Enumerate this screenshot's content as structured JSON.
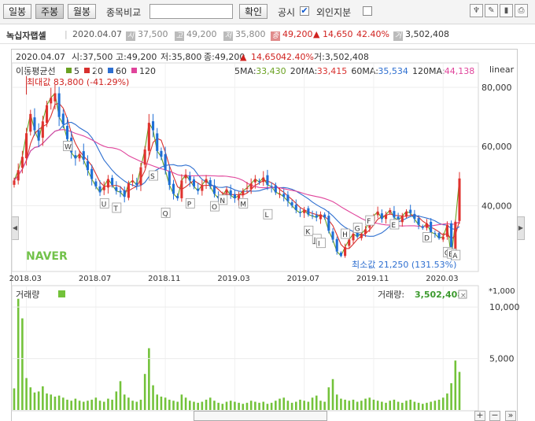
{
  "toolbar": {
    "tabs": [
      "일봉",
      "주봉",
      "월봉"
    ],
    "compare_label": "종목비교",
    "confirm_label": "확인",
    "gongsi_label": "공시",
    "foreign_label": "외인지분"
  },
  "info": {
    "name": "녹십자랩셀",
    "date": "2020.04.07",
    "open": "37,500",
    "high": "49,200",
    "low": "35,800",
    "close": "49,200",
    "change": "▲ 14,650",
    "change_pct": "42.40%",
    "volume": "3,502,408",
    "open_badge": "시",
    "high_badge": "고",
    "low_badge": "저",
    "close_badge": "종",
    "volume_badge": "거"
  },
  "chart": {
    "ohlc_line": {
      "date": "2020.04.07",
      "open_label": "시:",
      "open": "37,500",
      "high_label": "고:",
      "high": "49,200",
      "low_label": "저:",
      "low": "35,800",
      "close_label": "종:",
      "close": "49,200",
      "change": "14,650",
      "change_pct": "42.40%",
      "vol_label": "거:",
      "volume": "3,502,408"
    },
    "ma_header": "이동평균선",
    "scale_label": "linear",
    "max_label": "최대값 83,800 (-41.29%)",
    "min_label": "최소값 21,250 (131.53%)",
    "watermark": "NAVER",
    "volume_title": "거래량",
    "volume_current_label": "거래량:",
    "volume_current": "3,502,408",
    "volume_unit": "*1,000"
  },
  "chart_data": {
    "type": "candlestick",
    "interval": "weekly",
    "y_ticks": [
      40000,
      60000,
      80000
    ],
    "volume_ticks": [
      5000,
      10000
    ],
    "x_ticks": [
      "2018.03",
      "2018.07",
      "2018.11",
      "2019.03",
      "2019.07",
      "2019.11",
      "2020.03"
    ],
    "moving_averages": [
      {
        "period": "5",
        "label": "5MA:",
        "value": "33,430",
        "color": "#6aa121"
      },
      {
        "period": "20",
        "label": "20MA:",
        "value": "33,415",
        "color": "#d8302e"
      },
      {
        "period": "60",
        "label": "60MA:",
        "value": "35,534",
        "color": "#2e6fd0"
      },
      {
        "period": "120",
        "label": "120MA:",
        "value": "44,138",
        "color": "#e0449b"
      }
    ],
    "closes": [
      48500,
      52000,
      56500,
      64500,
      71000,
      65500,
      62000,
      68500,
      74000,
      76500,
      78000,
      70000,
      67500,
      62500,
      58000,
      56000,
      57500,
      55500,
      52000,
      49000,
      46500,
      44500,
      46500,
      49000,
      47000,
      45000,
      44500,
      43000,
      47500,
      48500,
      47000,
      53000,
      59000,
      68000,
      65500,
      58500,
      56500,
      52000,
      47000,
      44000,
      42500,
      48500,
      50500,
      48500,
      46500,
      45000,
      47000,
      49000,
      46500,
      44000,
      42500,
      43500,
      45500,
      43500,
      42500,
      43500,
      45000,
      46000,
      47500,
      49000,
      48000,
      49500,
      47000,
      46500,
      44500,
      44000,
      43000,
      41500,
      40000,
      38500,
      37500,
      38500,
      37000,
      36500,
      36000,
      37000,
      36000,
      31500,
      28500,
      24500,
      23000,
      26000,
      28500,
      30500,
      29500,
      30500,
      32000,
      35000,
      36500,
      38000,
      35500,
      37000,
      38500,
      36000,
      35000,
      36500,
      38000,
      37500,
      35500,
      33500,
      32500,
      34000,
      31000,
      30500,
      29000,
      29500,
      33500,
      22500,
      34550,
      49200
    ],
    "volumes": [
      2100,
      10800,
      8900,
      3100,
      2200,
      1700,
      1800,
      2300,
      1600,
      1500,
      1300,
      1400,
      1200,
      1000,
      900,
      1100,
      900,
      800,
      900,
      1000,
      1200,
      900,
      800,
      1100,
      1000,
      1800,
      2800,
      1500,
      1200,
      900,
      800,
      1000,
      3500,
      6000,
      2400,
      1500,
      1300,
      1200,
      1000,
      900,
      800,
      1500,
      1200,
      900,
      800,
      700,
      800,
      1000,
      1200,
      900,
      700,
      600,
      800,
      900,
      800,
      700,
      600,
      700,
      900,
      800,
      700,
      800,
      600,
      700,
      900,
      1100,
      1200,
      900,
      700,
      800,
      1000,
      900,
      800,
      1200,
      1400,
      900,
      800,
      2200,
      3000,
      1500,
      1100,
      1000,
      900,
      1000,
      800,
      900,
      1100,
      1200,
      1000,
      900,
      800,
      700,
      900,
      1000,
      800,
      700,
      900,
      1000,
      800,
      700,
      600,
      700,
      800,
      900,
      1000,
      1200,
      1600,
      2600,
      4800,
      3700
    ],
    "event_flags": [
      {
        "label": "W",
        "week": 13,
        "price": 60200
      },
      {
        "label": "U",
        "week": 22,
        "price": 40800
      },
      {
        "label": "T",
        "week": 25,
        "price": 39300
      },
      {
        "label": "S",
        "week": 34,
        "price": 50200
      },
      {
        "label": "Q",
        "week": 37,
        "price": 37600
      },
      {
        "label": "P",
        "week": 43,
        "price": 40800
      },
      {
        "label": "O",
        "week": 49,
        "price": 39800
      },
      {
        "label": "N",
        "week": 51,
        "price": 42000
      },
      {
        "label": "M",
        "week": 56,
        "price": 40800
      },
      {
        "label": "L",
        "week": 62,
        "price": 37100
      },
      {
        "label": "K",
        "week": 72,
        "price": 31500
      },
      {
        "label": "J",
        "week": 74,
        "price": 28700
      },
      {
        "label": "I",
        "week": 75,
        "price": 27400
      },
      {
        "label": "H",
        "week": 81,
        "price": 30500
      },
      {
        "label": "G",
        "week": 84,
        "price": 32500
      },
      {
        "label": "F",
        "week": 87,
        "price": 35000
      },
      {
        "label": "E",
        "week": 93,
        "price": 33700
      },
      {
        "label": "D",
        "week": 101,
        "price": 29300
      },
      {
        "label": "C",
        "week": 106,
        "price": 24300
      },
      {
        "label": "B",
        "week": 107,
        "price": 23800
      },
      {
        "label": "A",
        "week": 108,
        "price": 23300
      }
    ]
  }
}
